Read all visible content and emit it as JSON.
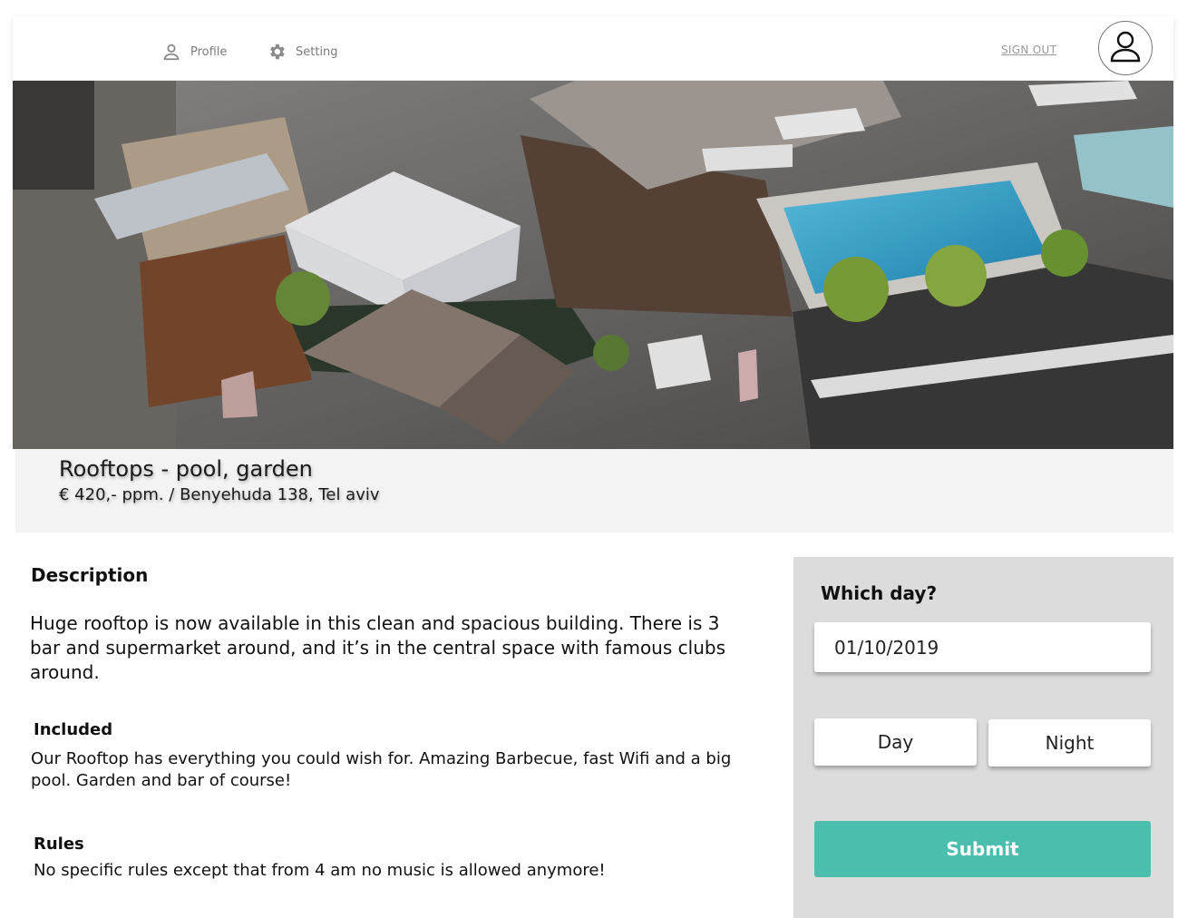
{
  "header": {
    "nav": [
      {
        "label": "Profile",
        "icon": "person-icon"
      },
      {
        "label": "Setting",
        "icon": "gear-icon"
      }
    ],
    "sign_out": "SIGN OUT",
    "avatar_icon": "user-avatar-icon"
  },
  "listing": {
    "title": "Rooftops - pool, garden",
    "subtitle": "€ 420,- ppm. /  Benyehuda 138, Tel aviv"
  },
  "details": {
    "description_heading": "Description",
    "description_text": "Huge rooftop is now available in this clean and spacious building. There is 3 bar and supermarket around, and it’s in the central space with famous  clubs around.",
    "included_heading": "Included",
    "included_text": "Our Rooftop has everything you could wish for. Amazing Barbecue, fast Wifi and a big pool. Garden and bar of course!",
    "rules_heading": "Rules",
    "rules_text": "No specific rules except that from 4 am no music is allowed anymore!"
  },
  "booking": {
    "question": "Which day?",
    "date_value": "01/10/2019",
    "day_label": "Day",
    "night_label": "Night",
    "submit_label": "Submit"
  },
  "colors": {
    "accent": "#4bbfad",
    "panel": "#dcdcdc",
    "band": "#f3f3f3"
  }
}
